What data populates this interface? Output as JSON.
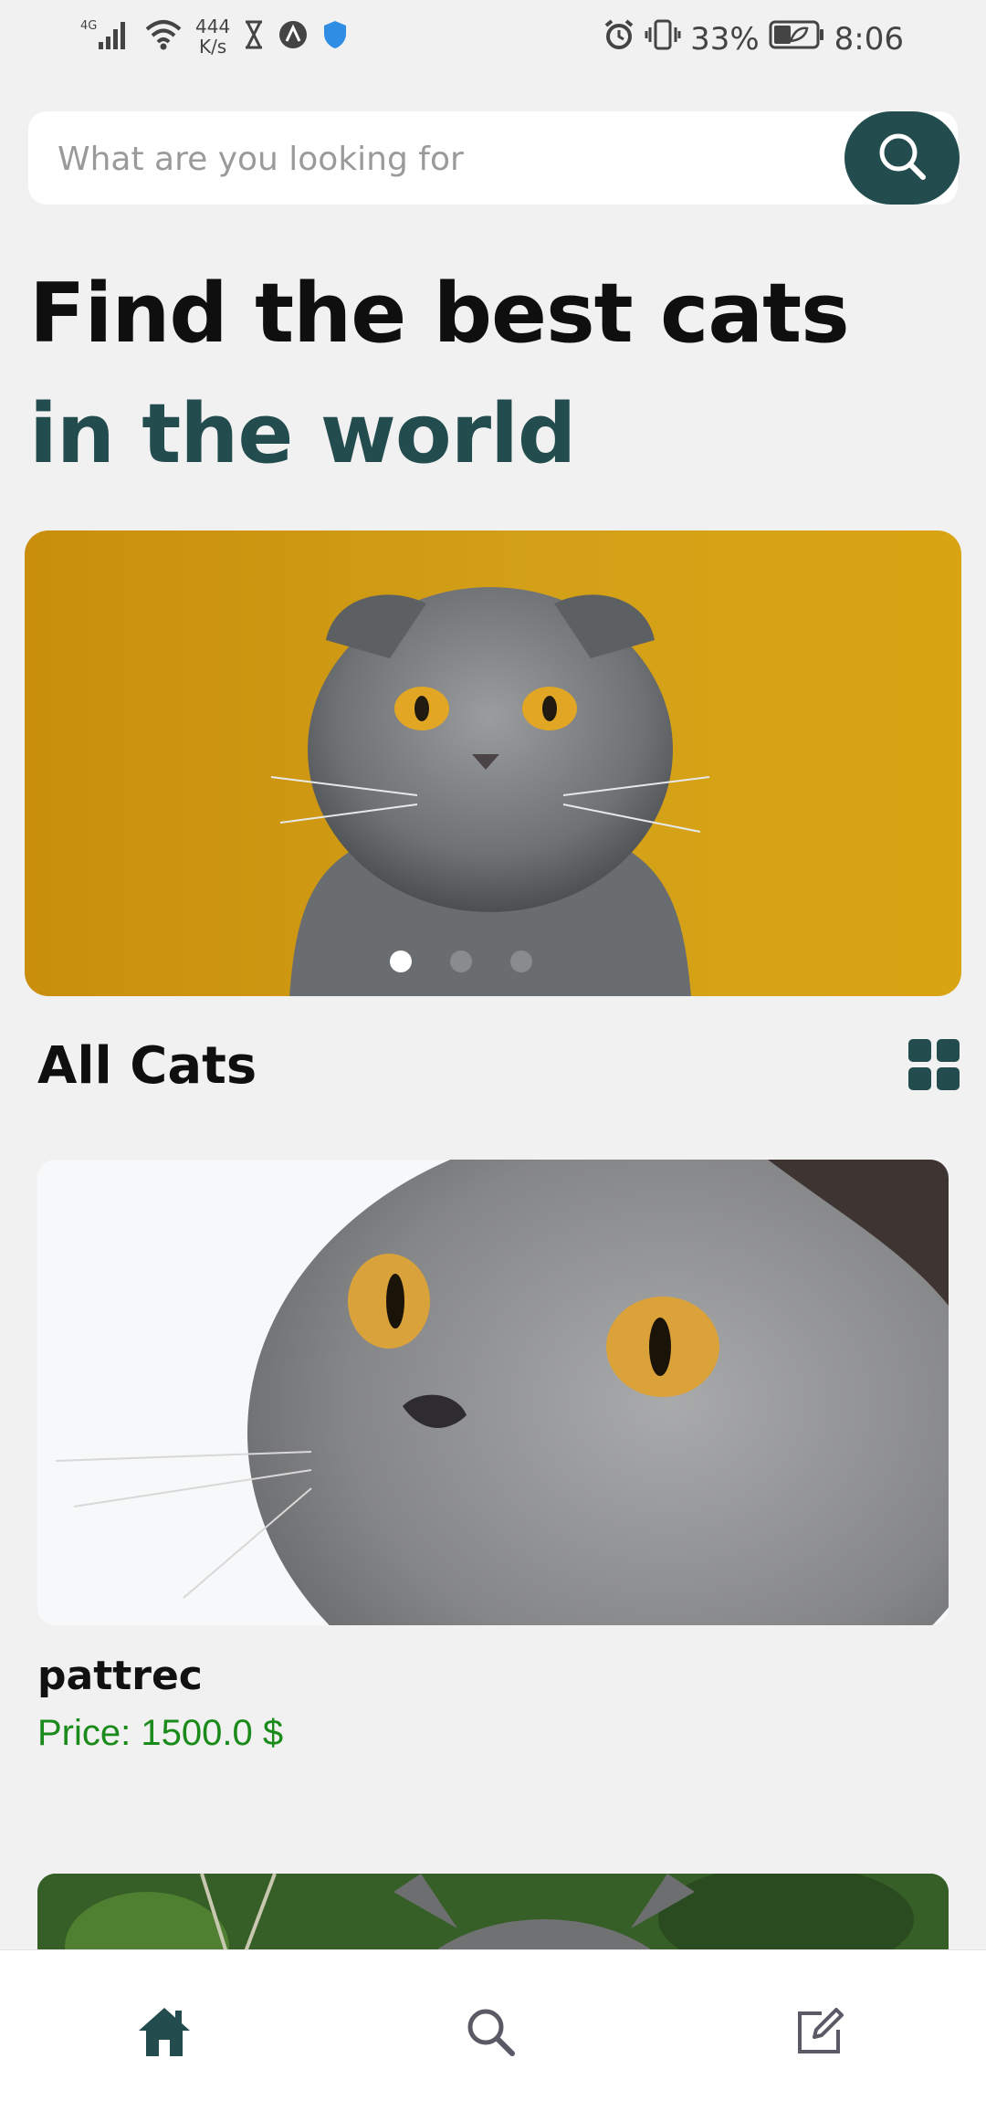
{
  "status_bar": {
    "network_type": "4G",
    "net_speed_value": "444",
    "net_speed_unit": "K/s",
    "battery": "33%",
    "time": "8:06"
  },
  "search": {
    "placeholder": "What are you looking for",
    "icon": "search-icon"
  },
  "hero": {
    "line1": "Find the best cats",
    "line2": "in the world"
  },
  "carousel": {
    "slide_count": 3,
    "active_index": 0
  },
  "section": {
    "title": "All Cats",
    "view_toggle_icon": "grid-icon"
  },
  "cats": [
    {
      "name": "pattrec",
      "price": "Price: 1500.0 $"
    }
  ],
  "bottom_nav": {
    "items": [
      {
        "icon": "home-icon",
        "active": true
      },
      {
        "icon": "search-icon",
        "active": false
      },
      {
        "icon": "edit-icon",
        "active": false
      }
    ]
  },
  "colors": {
    "accent": "#234c4e",
    "price": "#1a8a1a",
    "background": "#f1f1f1"
  }
}
